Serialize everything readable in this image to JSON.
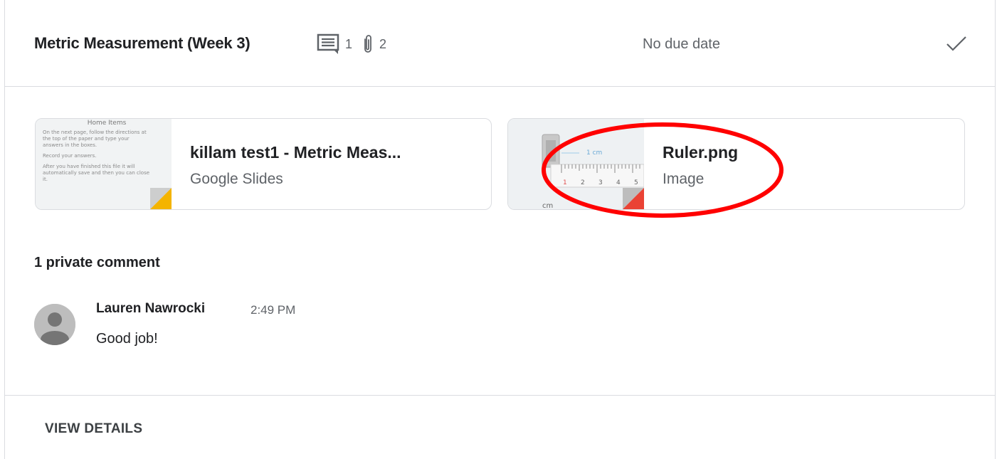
{
  "assignment": {
    "title": "Metric Measurement (Week 3)",
    "comment_count": "1",
    "attachment_count": "2",
    "due": "No due date"
  },
  "attachments": [
    {
      "title": "killam test1 - Metric Meas...",
      "type": "Google Slides"
    },
    {
      "title": "Ruler.png",
      "type": "Image"
    }
  ],
  "slide_thumb": {
    "heading": "Home Items",
    "lines": [
      "On the next page, follow the directions at",
      "the top of the paper and type your",
      "answers in the boxes.",
      "",
      "Record your answers.",
      "",
      "After you have finished this file it will",
      "automatically save and then you can close",
      "it."
    ]
  },
  "ruler_thumb": {
    "unit_label": "1 cm",
    "numbers": [
      "1",
      "2",
      "3",
      "4",
      "5"
    ],
    "cm_label": "cm"
  },
  "comments": {
    "heading": "1 private comment",
    "items": [
      {
        "author": "Lauren Nawrocki",
        "time": "2:49 PM",
        "text": "Good job!"
      }
    ]
  },
  "footer": {
    "view_details": "VIEW DETAILS"
  },
  "colors": {
    "slides_accent": "#f4b400",
    "image_accent": "#ea4335",
    "highlight": "#ff0000"
  }
}
